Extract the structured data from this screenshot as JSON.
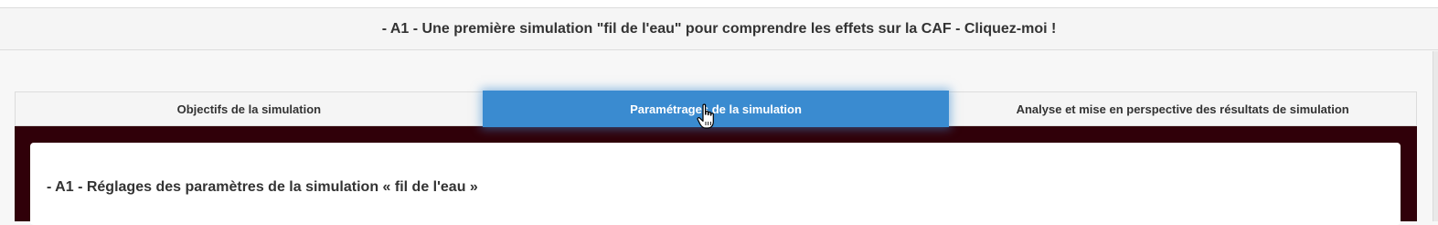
{
  "header": {
    "title": "- A1 - Une première simulation \"fil de l'eau\" pour comprendre les effets sur la CAF - Cliquez-moi !"
  },
  "tabs": [
    {
      "label": "Objectifs de la simulation",
      "active": false
    },
    {
      "label": "Paramétrages de la simulation",
      "active": true
    },
    {
      "label": "Analyse et mise en perspective des résultats de simulation",
      "active": false
    }
  ],
  "content": {
    "section_title": "- A1 - Réglages des paramètres de la simulation « fil de l'eau »"
  },
  "colors": {
    "active_tab": "#3a8bd0",
    "panel_background": "#300009"
  },
  "cursor": {
    "icon": "hand-pointer-icon"
  }
}
